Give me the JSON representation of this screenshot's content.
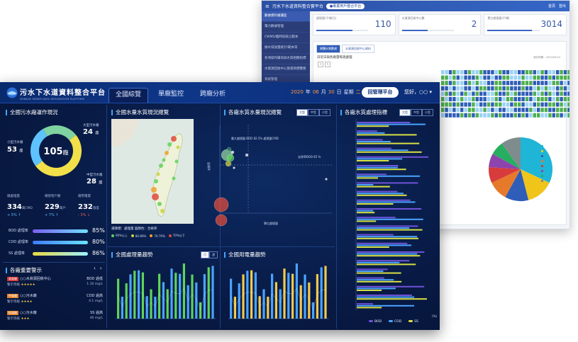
{
  "back": {
    "title": "污水下水道資料整合實平台",
    "pill": "●專業用戶整合平台",
    "user_links": [
      "首頁",
      "登出"
    ],
    "sidebar": [
      "數據資料維護區",
      "電力數據管理",
      "CWMS/臨時紀錄之範本",
      "廢水排放量統計/範本等",
      "各項操作績效與水質相關指標",
      "水資源回收中心營運目標實務",
      "系統管理"
    ],
    "cards": [
      {
        "label": "處理量(千噸/日)",
        "value": "110",
        "pct": 0.7
      },
      {
        "label": "水資源回收中心數",
        "value": "2",
        "pct": 0.5
      },
      {
        "label": "累計處理量(千噸)",
        "value": "3014",
        "pct": 0.85
      }
    ],
    "tabs": [
      "總體水質數據",
      "水資源回收中心資料"
    ],
    "panel_title": "日近日與各廠量每週處理",
    "chart_note": "統計時間：2020/05/24"
  },
  "front": {
    "brand_title": "污水下水道資料整合平台",
    "brand_sub": "SEWAGE SEWER DATA INTEGRATION PLATFORM",
    "nav": [
      "全國綜覽",
      "單廠監控",
      "跨廠分析"
    ],
    "date": {
      "year": "2020",
      "year_unit": "年",
      "month": "06",
      "month_unit": "月",
      "day": "30",
      "day_unit": "日",
      "weekday_label": "星期",
      "weekday": "二"
    },
    "platform_button": "回管理平台",
    "user": "您好，○○ ▾",
    "overview": {
      "title": "全國污水廠運作現況",
      "total": "105",
      "total_unit": "廠",
      "small_label": "小型污水廠",
      "small_value": "53",
      "small_unit": "座",
      "large_label": "大型污水廠",
      "large_value": "24",
      "large_unit": "座",
      "mid_label": "中型污水廠",
      "mid_value": "28",
      "mid_unit": "座",
      "stats": [
        {
          "label": "總處理量",
          "value": "334",
          "unit": "萬CMD",
          "change": "+ 5% ↑",
          "color": "#5ec2ff"
        },
        {
          "label": "總接管戶數",
          "value": "229",
          "unit": "萬戶",
          "change": "+ 7% ↑",
          "color": "#5ec2ff"
        },
        {
          "label": "總用電量",
          "value": "232",
          "unit": "億度",
          "change": "- 3% ↓",
          "color": "#ff5a5a"
        }
      ],
      "rates": [
        {
          "label": "BOD 處理率",
          "value": "85",
          "unit": "%"
        },
        {
          "label": "COD 處理率",
          "value": "80",
          "unit": "%"
        },
        {
          "label": "SS 處理率",
          "value": "86",
          "unit": "%"
        }
      ]
    },
    "alerts": {
      "title": "各廠重要警示",
      "items": [
        {
          "tag": "高風險",
          "tag_color": "#d63535",
          "name": "○○水資源回收中心",
          "metric": "BOD 過低",
          "level_label": "警示等級",
          "stars": "★★★★★",
          "value": "1.16 mg/L"
        },
        {
          "tag": "中風險",
          "tag_color": "#e5832b",
          "name": "○○污水廠",
          "metric": "COD 過高",
          "level_label": "警示等級",
          "stars": "★★★★",
          "value": "4.1 mg/L"
        },
        {
          "tag": "低風險",
          "tag_color": "#e5832b",
          "name": "○○污水廠",
          "metric": "SS 過高",
          "level_label": "警示等級",
          "stars": "★★★",
          "value": "46 mg/L"
        }
      ]
    },
    "map": {
      "title": "全國水量水質現況總覽",
      "legend_title": "選擇標：處理量  圓顏色：合格率",
      "legend": [
        {
          "label": "90%以上",
          "color": "#5fd35a"
        },
        {
          "label": "80-89%",
          "color": "#c9d43b"
        },
        {
          "label": "70-79%",
          "color": "#f0a02c"
        },
        {
          "label": "70%以下",
          "color": "#e04a3a"
        }
      ]
    },
    "scatter": {
      "title": "各廠水質水量現況總覽",
      "segments": [
        "大型",
        "中型",
        "小型"
      ],
      "note1": "最大處理量 BOD 82.5% 處理量CMD",
      "note2": "去除率BOD 85 %",
      "xlabel": "單位處理量",
      "ylabel": "去除率"
    },
    "quality": {
      "title": "各廠水質處理指標",
      "segments": [
        "大型",
        "中型",
        "小型"
      ],
      "legend": [
        {
          "label": "BOD",
          "color": "#6e52d8"
        },
        {
          "label": "COD",
          "color": "#4aa3ff"
        },
        {
          "label": "SS",
          "color": "#d8e043"
        }
      ],
      "x_unit": "(%)"
    },
    "trend1": {
      "title": "全國處理量趨勢",
      "toggle": [
        "日",
        "週"
      ]
    },
    "trend2": {
      "title": "全國用電量趨勢"
    }
  }
}
